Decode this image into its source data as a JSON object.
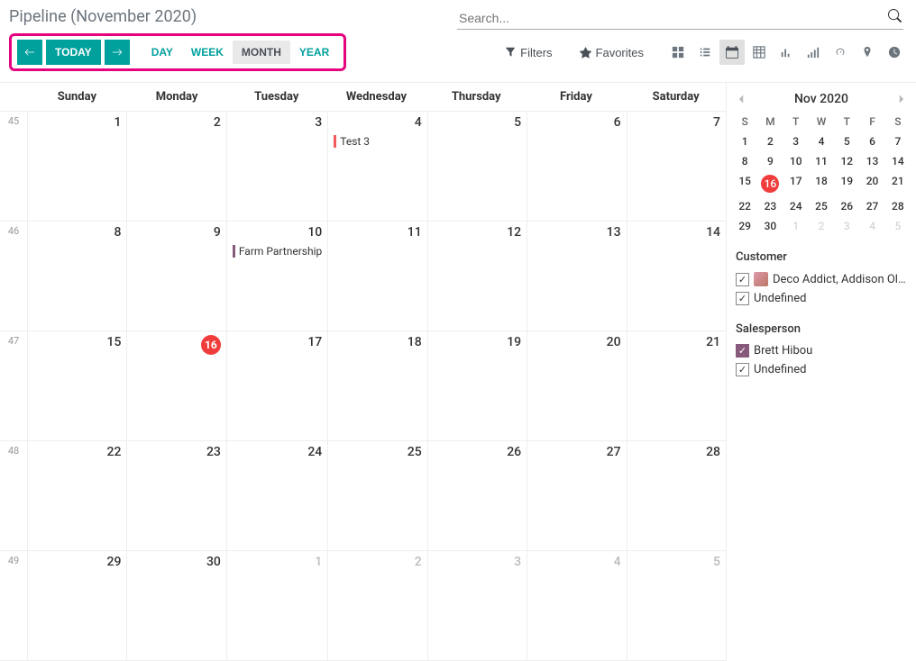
{
  "title": "Pipeline (November 2020)",
  "search_placeholder": "Search...",
  "nav": {
    "today": "TODAY",
    "views": [
      "DAY",
      "WEEK",
      "MONTH",
      "YEAR"
    ],
    "active_view": "MONTH"
  },
  "toolbar": {
    "filters": "Filters",
    "favorites": "Favorites"
  },
  "calendar": {
    "dow": [
      "Sunday",
      "Monday",
      "Tuesday",
      "Wednesday",
      "Thursday",
      "Friday",
      "Saturday"
    ],
    "weeks": [
      {
        "num": "45",
        "days": [
          {
            "n": "1"
          },
          {
            "n": "2"
          },
          {
            "n": "3"
          },
          {
            "n": "4",
            "events": [
              {
                "label": "Test 3",
                "color": "#f35b5b"
              }
            ]
          },
          {
            "n": "5"
          },
          {
            "n": "6"
          },
          {
            "n": "7"
          }
        ]
      },
      {
        "num": "46",
        "days": [
          {
            "n": "8"
          },
          {
            "n": "9"
          },
          {
            "n": "10",
            "events": [
              {
                "label": "Farm Partnership",
                "color": "#875a7b"
              }
            ]
          },
          {
            "n": "11"
          },
          {
            "n": "12"
          },
          {
            "n": "13"
          },
          {
            "n": "14"
          }
        ]
      },
      {
        "num": "47",
        "days": [
          {
            "n": "15"
          },
          {
            "n": "16",
            "today": true
          },
          {
            "n": "17"
          },
          {
            "n": "18"
          },
          {
            "n": "19"
          },
          {
            "n": "20"
          },
          {
            "n": "21"
          }
        ]
      },
      {
        "num": "48",
        "days": [
          {
            "n": "22"
          },
          {
            "n": "23"
          },
          {
            "n": "24"
          },
          {
            "n": "25"
          },
          {
            "n": "26"
          },
          {
            "n": "27"
          },
          {
            "n": "28"
          }
        ]
      },
      {
        "num": "49",
        "days": [
          {
            "n": "29"
          },
          {
            "n": "30"
          },
          {
            "n": "1",
            "muted": true
          },
          {
            "n": "2",
            "muted": true
          },
          {
            "n": "3",
            "muted": true
          },
          {
            "n": "4",
            "muted": true
          },
          {
            "n": "5",
            "muted": true
          }
        ]
      }
    ]
  },
  "mini": {
    "title": "Nov 2020",
    "dow": [
      "S",
      "M",
      "T",
      "W",
      "T",
      "F",
      "S"
    ],
    "days": [
      {
        "n": "1"
      },
      {
        "n": "2"
      },
      {
        "n": "3"
      },
      {
        "n": "4"
      },
      {
        "n": "5"
      },
      {
        "n": "6"
      },
      {
        "n": "7"
      },
      {
        "n": "8"
      },
      {
        "n": "9"
      },
      {
        "n": "10"
      },
      {
        "n": "11"
      },
      {
        "n": "12"
      },
      {
        "n": "13"
      },
      {
        "n": "14"
      },
      {
        "n": "15"
      },
      {
        "n": "16",
        "today": true
      },
      {
        "n": "17"
      },
      {
        "n": "18"
      },
      {
        "n": "19"
      },
      {
        "n": "20"
      },
      {
        "n": "21"
      },
      {
        "n": "22"
      },
      {
        "n": "23"
      },
      {
        "n": "24"
      },
      {
        "n": "25"
      },
      {
        "n": "26"
      },
      {
        "n": "27"
      },
      {
        "n": "28"
      },
      {
        "n": "29"
      },
      {
        "n": "30"
      },
      {
        "n": "1",
        "muted": true
      },
      {
        "n": "2",
        "muted": true
      },
      {
        "n": "3",
        "muted": true
      },
      {
        "n": "4",
        "muted": true
      },
      {
        "n": "5",
        "muted": true
      }
    ]
  },
  "filters": {
    "customer": {
      "title": "Customer",
      "items": [
        {
          "label": "Deco Addict, Addison Ol…",
          "checked": true,
          "avatar": true
        },
        {
          "label": "Undefined",
          "checked": true
        }
      ]
    },
    "salesperson": {
      "title": "Salesperson",
      "items": [
        {
          "label": "Brett Hibou",
          "checked": true,
          "purple": true
        },
        {
          "label": "Undefined",
          "checked": true
        }
      ]
    }
  }
}
